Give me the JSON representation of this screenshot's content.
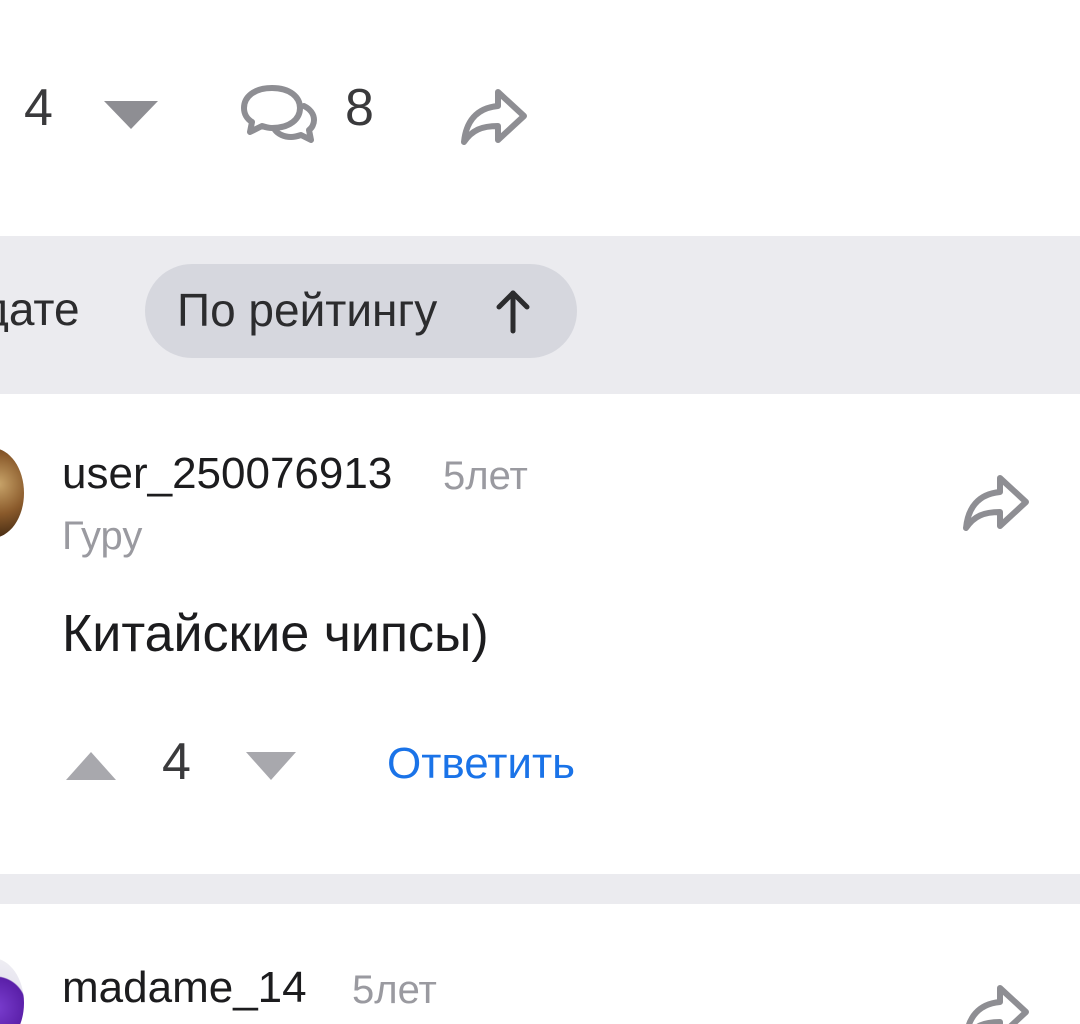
{
  "post_actions": {
    "vote_count": "4",
    "comments_count": "8",
    "icons": [
      "vote-down-icon",
      "comments-icon",
      "share-icon"
    ]
  },
  "sort": {
    "by_date_label": "дате",
    "by_rating_label": "По рейтингу",
    "sort_direction_icon": "arrow-up-icon"
  },
  "comments": [
    {
      "username": "user_250076913",
      "time": "5лет",
      "rank": "Гуру",
      "text": "Китайские чипсы)",
      "vote_count": "4",
      "reply_label": "Ответить"
    },
    {
      "username": "madame_14",
      "time": "5лет"
    }
  ],
  "colors": {
    "accent": "#1a73e8",
    "sort_bar_bg": "#ebebef",
    "pill_bg": "#d6d7de",
    "muted_text": "#9a9aa0"
  }
}
